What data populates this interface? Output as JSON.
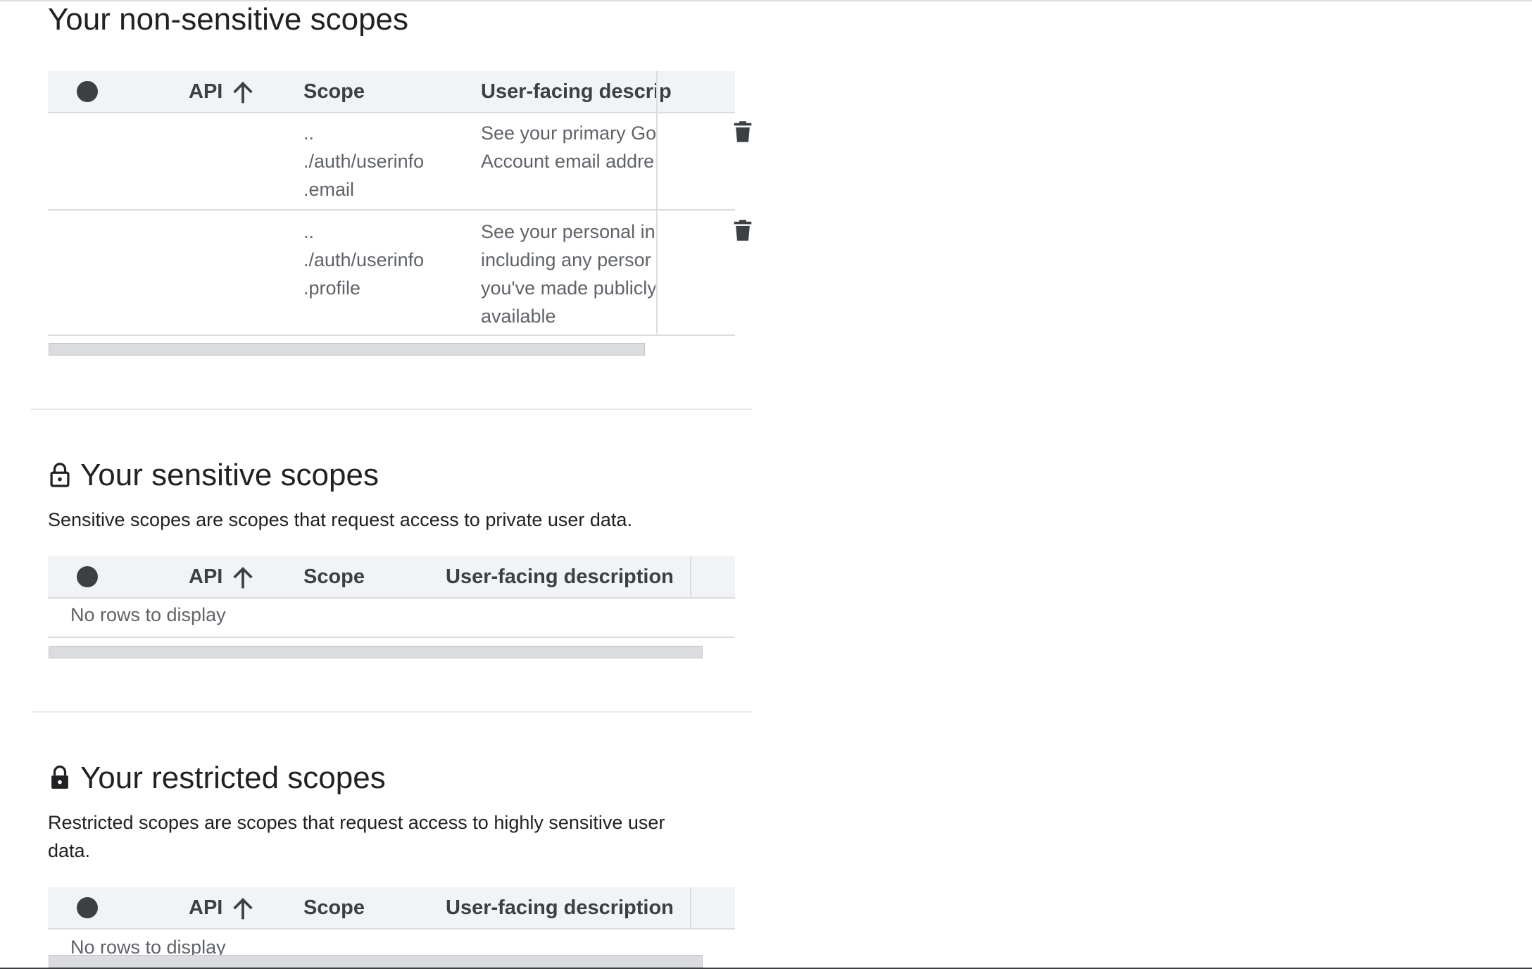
{
  "non_sensitive": {
    "title": "Your non-sensitive scopes",
    "columns": {
      "api": "API",
      "scope": "Scope",
      "description": "User-facing descrip"
    },
    "rows": [
      {
        "scope_lines": [
          "..",
          "./auth/userinfo",
          ".email"
        ],
        "desc_lines": [
          "See your primary Go",
          "Account email addre"
        ]
      },
      {
        "scope_lines": [
          "..",
          "./auth/userinfo",
          ".profile"
        ],
        "desc_lines": [
          "See your personal in",
          "including any persor",
          "you've made publicly",
          "available"
        ]
      }
    ]
  },
  "sensitive": {
    "title": "Your sensitive scopes",
    "description": "Sensitive scopes are scopes that request access to private user data.",
    "columns": {
      "api": "API",
      "scope": "Scope",
      "description": "User-facing description"
    },
    "empty": "No rows to display"
  },
  "restricted": {
    "title": "Your restricted scopes",
    "description_lines": [
      "Restricted scopes are scopes that request access to highly sensitive user",
      "data."
    ],
    "columns": {
      "api": "API",
      "scope": "Scope",
      "description": "User-facing description"
    },
    "empty": "No rows to display"
  },
  "icons": {
    "select_all": "circle-select-icon",
    "sort": "arrow-up-icon",
    "delete": "trash-icon",
    "lock_open": "lock-open-icon",
    "lock": "lock-icon"
  }
}
